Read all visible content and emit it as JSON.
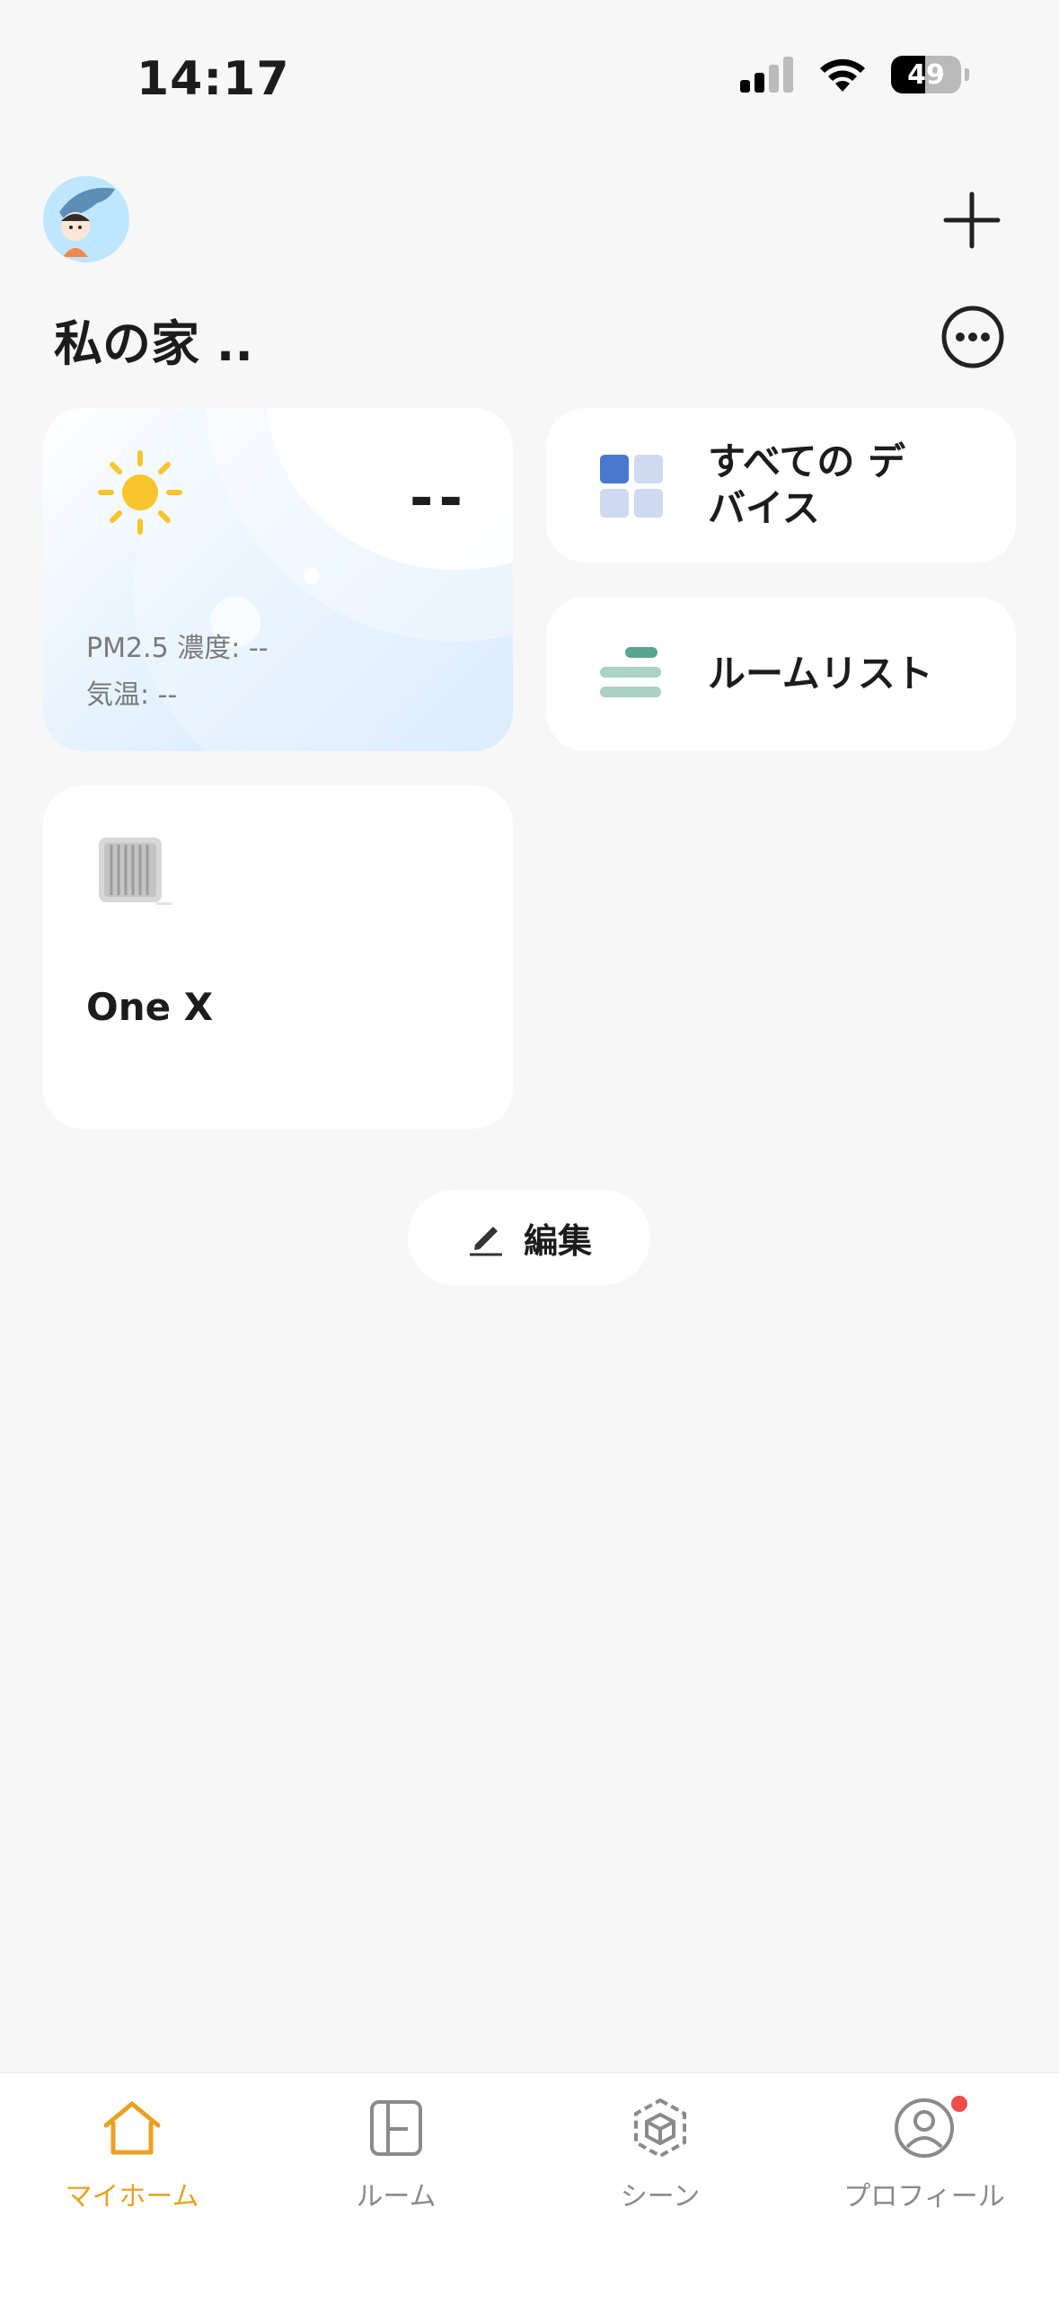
{
  "status_bar": {
    "time": "14:17",
    "battery": "49"
  },
  "header": {
    "home_name": "私の家 .."
  },
  "weather": {
    "temperature": "--",
    "pm25": "PM2.5 濃度: --",
    "temp_label": "気温: --"
  },
  "quick_links": {
    "all_devices": "すべての デバイス",
    "room_list": "ルームリスト"
  },
  "devices": [
    {
      "name": "One X"
    }
  ],
  "edit_label": "編集",
  "bottom_nav": {
    "home": "マイホーム",
    "room": "ルーム",
    "scene": "シーン",
    "profile": "プロフィール"
  },
  "colors": {
    "accent": "#e8a123",
    "badge": "#f24a46",
    "tile_blue": "#4a78cf",
    "tile_light": "#cfd9f0",
    "bar_green": "#5aa58f"
  }
}
